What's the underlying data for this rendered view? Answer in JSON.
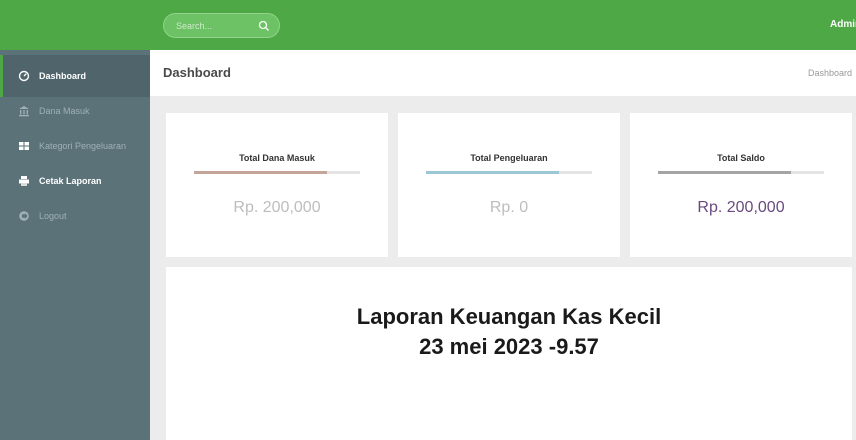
{
  "topbar": {
    "search_placeholder": "Search...",
    "user_label": "Admin"
  },
  "sidebar": {
    "items": [
      {
        "label": "Dashboard",
        "icon": "dashboard-icon",
        "active": true
      },
      {
        "label": "Dana Masuk",
        "icon": "bank-icon"
      },
      {
        "label": "Kategori Pengeluaran",
        "icon": "grid-icon"
      },
      {
        "label": "Cetak Laporan",
        "icon": "print-icon"
      },
      {
        "label": "Logout",
        "icon": "logout-icon"
      }
    ]
  },
  "header": {
    "title": "Dashboard",
    "breadcrumb": "Dashboard"
  },
  "cards": [
    {
      "title": "Total Dana Masuk",
      "value": "Rp. 200,000",
      "bar_color": "#c5a59a",
      "value_color": "#bdbdbd",
      "progress": 0.8
    },
    {
      "title": "Total Pengeluaran",
      "value": "Rp. 0",
      "bar_color": "#9ec7d6",
      "value_color": "#bdbdbd",
      "progress": 0.8
    },
    {
      "title": "Total Saldo",
      "value": "Rp. 200,000",
      "bar_color": "#a4a4a4",
      "value_color": "#6a4a7e",
      "progress": 0.8
    }
  ],
  "report": {
    "line1": "Laporan Keuangan Kas Kecil",
    "line2": "23 mei 2023 -9.57"
  },
  "colors": {
    "topbar": "#4ea845",
    "sidebar": "#5b7279",
    "sidebar_active": "#4f656b"
  }
}
